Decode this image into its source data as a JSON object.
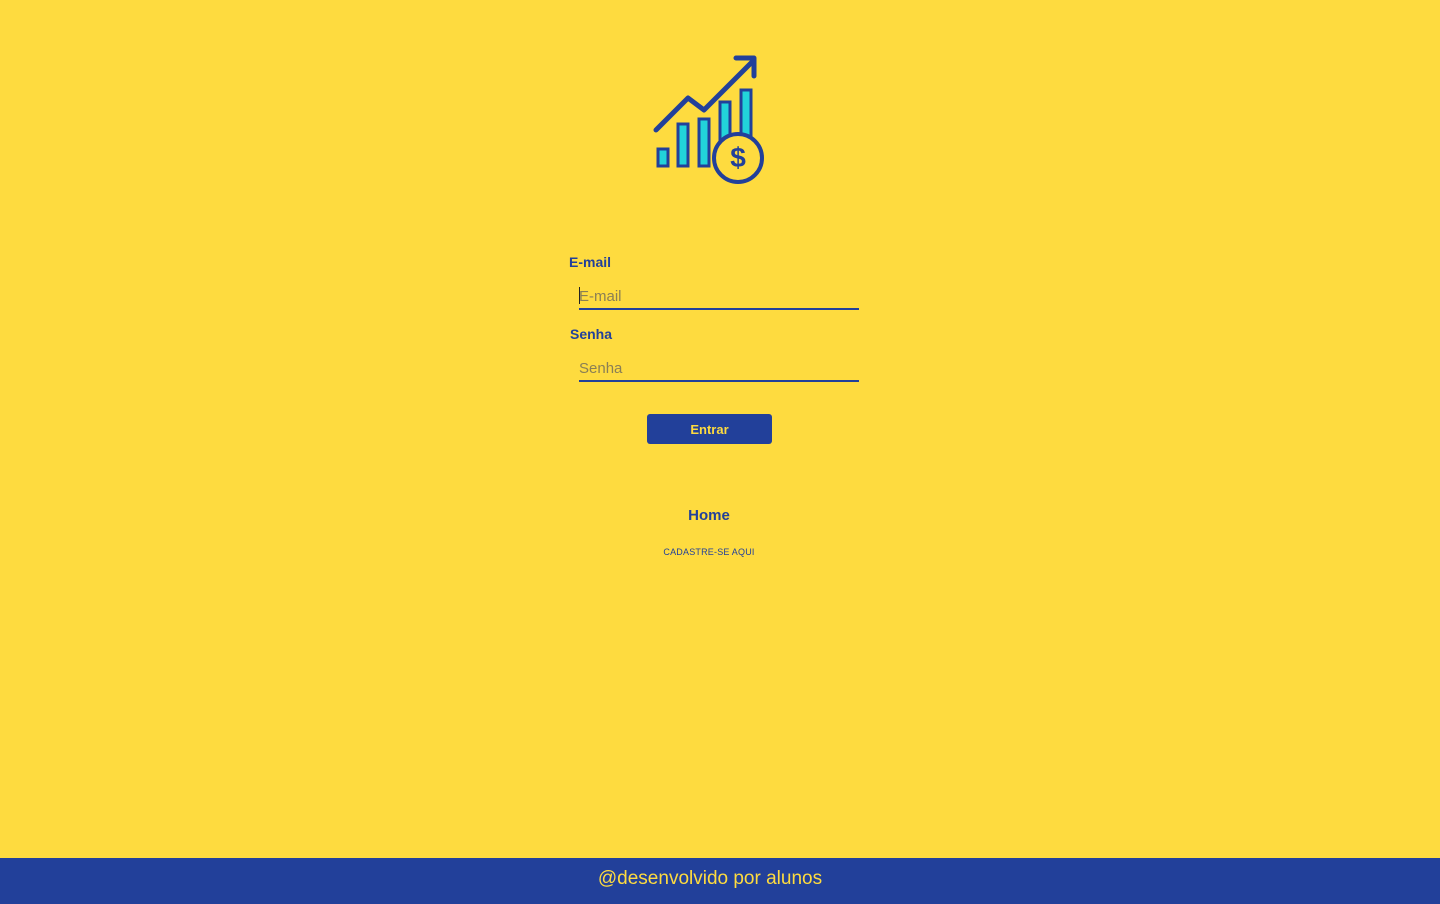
{
  "logo": {
    "icon": "growth-chart-dollar-icon",
    "colors": {
      "primary": "#22409A",
      "accent": "#22D3DA"
    }
  },
  "form": {
    "email": {
      "label": "E-mail",
      "placeholder": "E-mail",
      "value": ""
    },
    "senha": {
      "label": "Senha",
      "placeholder": "Senha",
      "value": ""
    },
    "submit_label": "Entrar"
  },
  "links": {
    "home": "Home",
    "register": "CADASTRE-SE AQUI"
  },
  "footer": {
    "text": "@desenvolvido por alunos"
  },
  "theme": {
    "background": "#FEDB3F",
    "primary": "#22409A"
  }
}
